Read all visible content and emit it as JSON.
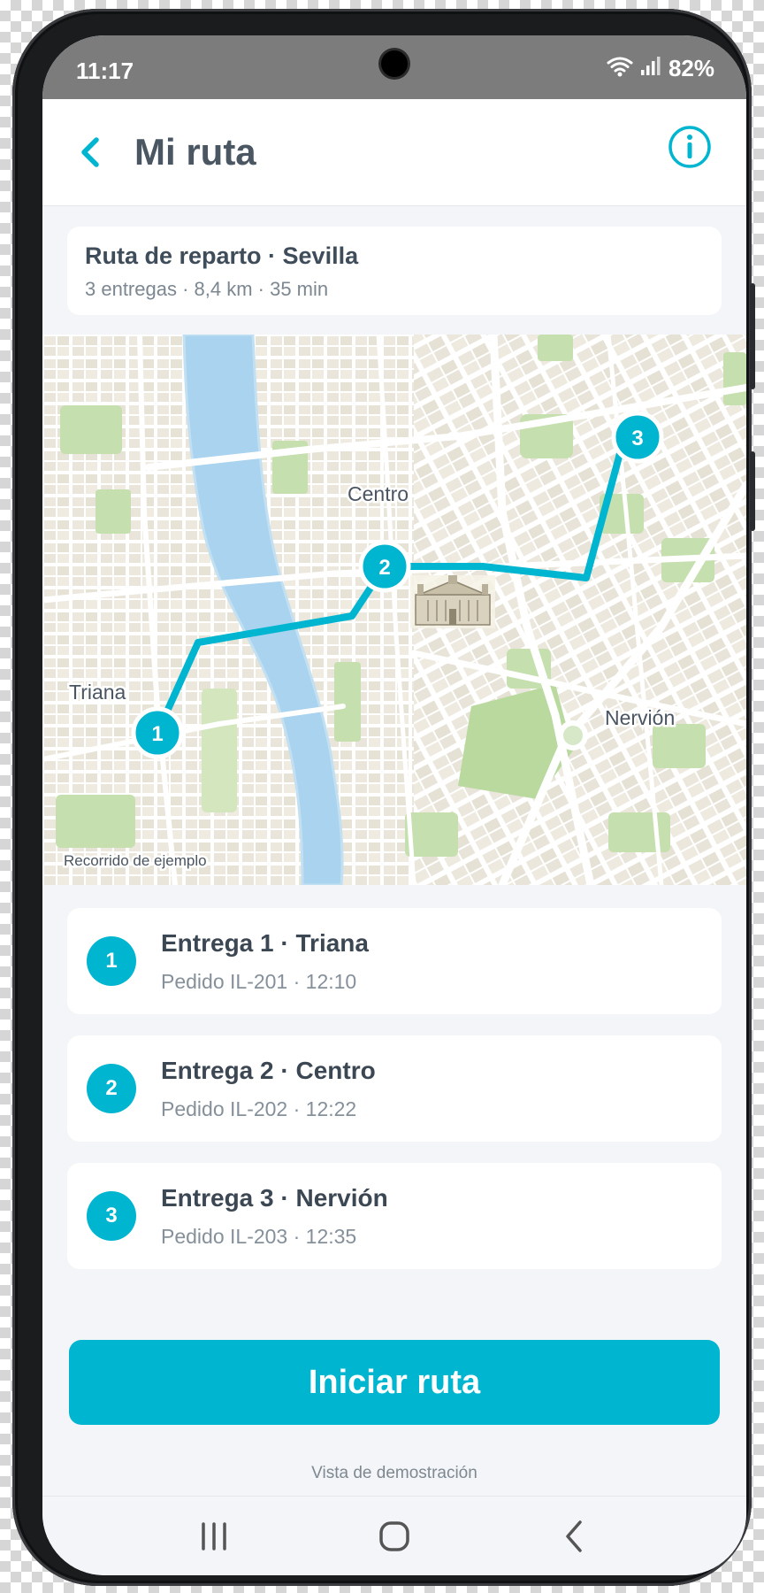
{
  "status_bar": {
    "time": "11:17",
    "battery": "82%"
  },
  "header": {
    "title": "Mi ruta"
  },
  "summary": {
    "title": "Ruta de reparto · Sevilla",
    "subtitle": "3 entregas · 8,4 km · 35 min"
  },
  "map": {
    "labels": {
      "centro": "Centro",
      "triana": "Triana",
      "nervion": "Nervión"
    },
    "caption": "Recorrido de ejemplo",
    "markers": [
      "1",
      "2",
      "3"
    ],
    "route_color": "#00b5d0"
  },
  "stops": [
    {
      "number": "1",
      "title": "Entrega 1 · Triana",
      "detail": "Pedido IL-201 · 12:10"
    },
    {
      "number": "2",
      "title": "Entrega 2 · Centro",
      "detail": "Pedido IL-202 · 12:22"
    },
    {
      "number": "3",
      "title": "Entrega 3 · Nervión",
      "detail": "Pedido IL-203 · 12:35"
    }
  ],
  "cta": {
    "label": "Iniciar ruta"
  },
  "footer_note": "Vista de demostración",
  "colors": {
    "accent": "#00b5d0",
    "text_dark": "#3c4754",
    "text_muted": "#85909a"
  },
  "icons": {
    "back": "chevron-left-icon",
    "info": "info-circle-icon",
    "wifi": "wifi-icon",
    "signal": "signal-icon",
    "nav_recent": "recent-apps-icon",
    "nav_home": "home-icon",
    "nav_back": "back-icon"
  }
}
